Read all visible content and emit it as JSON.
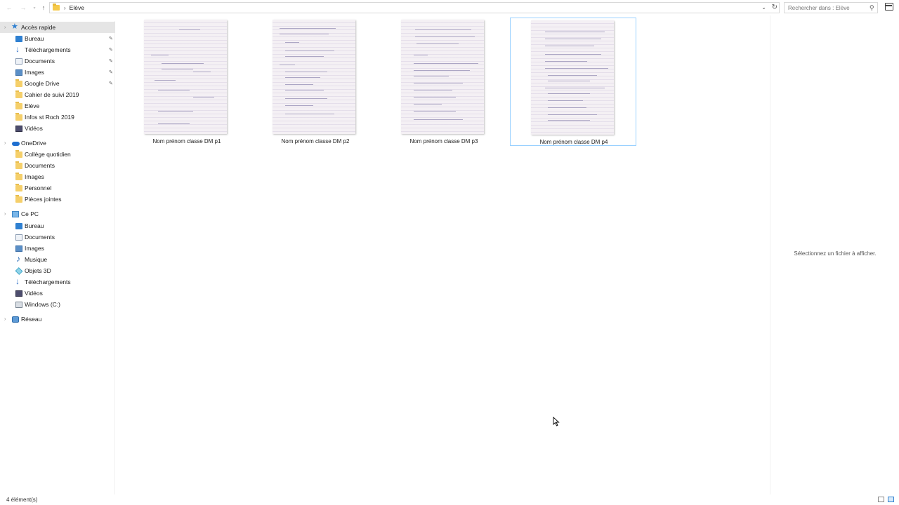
{
  "address_bar": {
    "path": [
      "Elève"
    ],
    "search_placeholder": "Rechercher dans : Elève"
  },
  "sidebar": {
    "quick_access": {
      "label": "Accès rapide",
      "items": [
        {
          "label": "Bureau",
          "icon": "desktop-icon",
          "pinned": true
        },
        {
          "label": "Téléchargements",
          "icon": "download-icon",
          "pinned": true
        },
        {
          "label": "Documents",
          "icon": "documents-icon",
          "pinned": true
        },
        {
          "label": "Images",
          "icon": "images-icon",
          "pinned": true
        },
        {
          "label": "Google Drive",
          "icon": "folder-icon",
          "pinned": true
        },
        {
          "label": "Cahier de suivi 2019",
          "icon": "folder-icon",
          "pinned": false
        },
        {
          "label": "Elève",
          "icon": "folder-icon",
          "pinned": false
        },
        {
          "label": "Infos st Roch 2019",
          "icon": "folder-icon",
          "pinned": false
        },
        {
          "label": "Vidéos",
          "icon": "videos-icon",
          "pinned": false
        }
      ]
    },
    "onedrive": {
      "label": "OneDrive",
      "items": [
        {
          "label": "Collège quotidien"
        },
        {
          "label": "Documents"
        },
        {
          "label": "Images"
        },
        {
          "label": "Personnel"
        },
        {
          "label": "Pièces jointes"
        }
      ]
    },
    "this_pc": {
      "label": "Ce PC",
      "items": [
        {
          "label": "Bureau",
          "icon": "desktop-icon"
        },
        {
          "label": "Documents",
          "icon": "documents-icon"
        },
        {
          "label": "Images",
          "icon": "images-icon"
        },
        {
          "label": "Musique",
          "icon": "music-icon"
        },
        {
          "label": "Objets 3D",
          "icon": "3d-objects-icon"
        },
        {
          "label": "Téléchargements",
          "icon": "download-icon"
        },
        {
          "label": "Vidéos",
          "icon": "videos-icon"
        },
        {
          "label": "Windows (C:)",
          "icon": "drive-icon"
        }
      ]
    },
    "network": {
      "label": "Réseau"
    }
  },
  "files": [
    {
      "name": "Nom prénom classe DM p1",
      "selected": false
    },
    {
      "name": "Nom prénom classe DM p2",
      "selected": false
    },
    {
      "name": "Nom prénom classe DM p3",
      "selected": false
    },
    {
      "name": "Nom prénom classe DM p4",
      "selected": true
    }
  ],
  "preview_pane": {
    "message": "Sélectionnez un fichier à afficher."
  },
  "status_bar": {
    "count": "4 élément(s)"
  },
  "colors": {
    "accent": "#2f80d1",
    "selection_border": "#99d1ff",
    "sidebar_selected": "#e5e5e5"
  }
}
